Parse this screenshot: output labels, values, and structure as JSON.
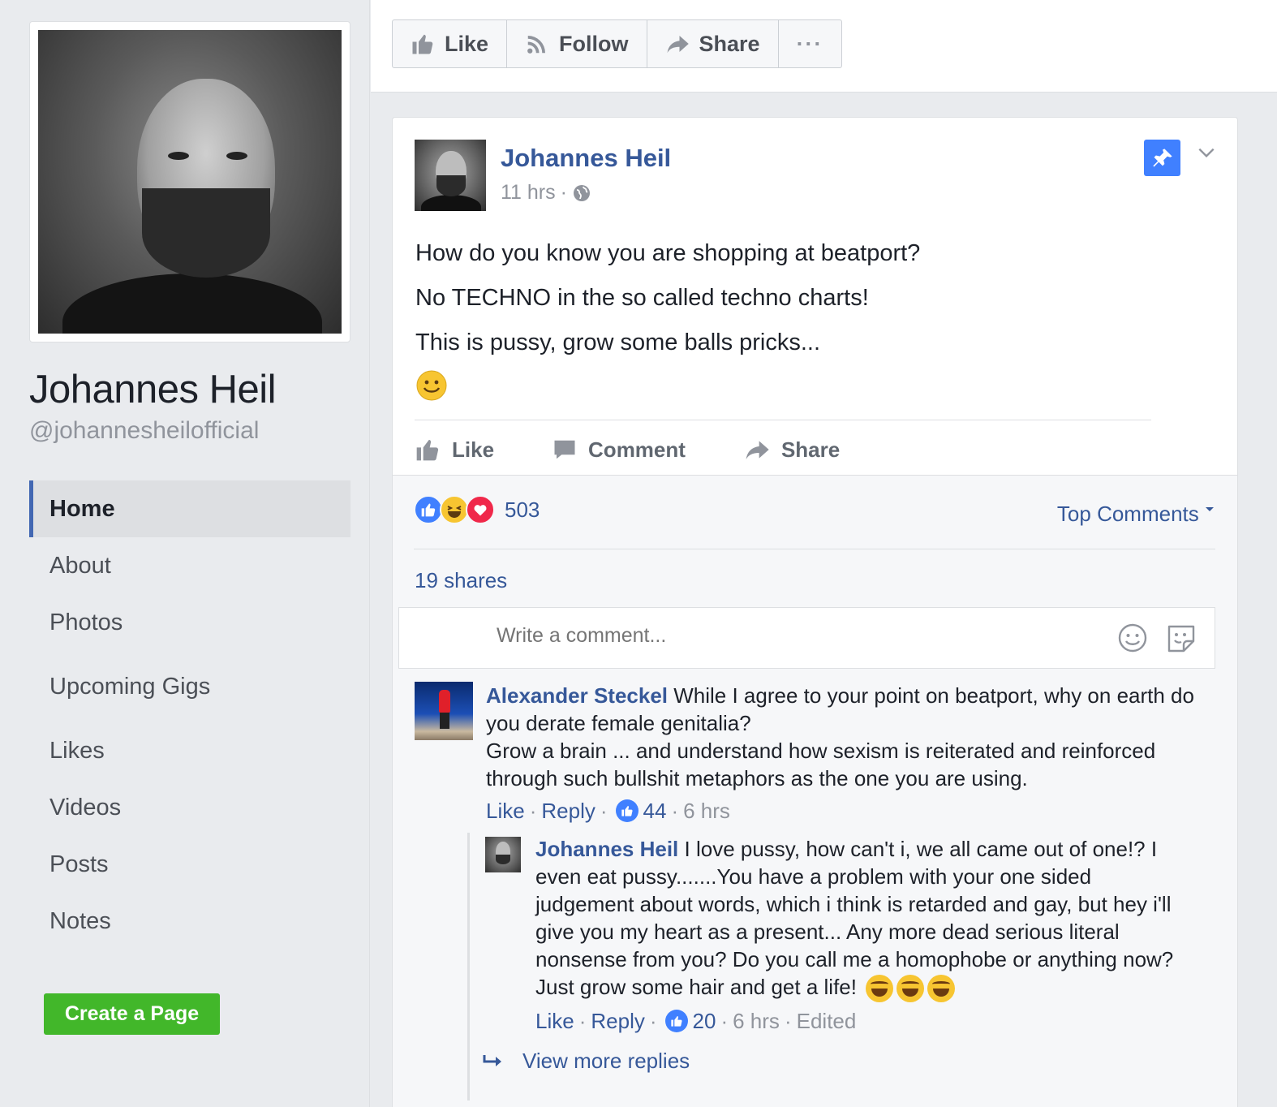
{
  "page": {
    "name": "Johannes Heil",
    "handle": "@johannesheilofficial"
  },
  "nav": {
    "items": [
      {
        "label": "Home"
      },
      {
        "label": "About"
      },
      {
        "label": "Photos"
      },
      {
        "label": "Upcoming Gigs"
      },
      {
        "label": "Likes"
      },
      {
        "label": "Videos"
      },
      {
        "label": "Posts"
      },
      {
        "label": "Notes"
      }
    ],
    "create_page": "Create a Page"
  },
  "actions": {
    "like": "Like",
    "follow": "Follow",
    "share": "Share",
    "more": "···"
  },
  "post": {
    "author": "Johannes Heil",
    "time": "11 hrs",
    "separator": "·",
    "lines": [
      "How do you know you are shopping at beatport?",
      "No TECHNO in the so called techno charts!",
      "This is pussy, grow some balls pricks..."
    ],
    "buttons": {
      "like": "Like",
      "comment": "Comment",
      "share": "Share"
    }
  },
  "feedback": {
    "reaction_count": "503",
    "top_comments": "Top Comments",
    "shares": "19 shares",
    "write_placeholder": "Write a comment..."
  },
  "comments": [
    {
      "author": "Alexander Steckel",
      "text1": "While I agree to your point on beatport, why on earth do you derate female genitalia?",
      "text2": "Grow a brain ... and understand how sexism is reiterated and reinforced through such bullshit metaphors as the one you are using.",
      "like": "Like",
      "reply": "Reply",
      "likes": "44",
      "time": "6 hrs"
    },
    {
      "author": "Johannes Heil",
      "text": "I love pussy, how can't i, we all came out of one!? I even eat pussy.......You have a problem with your one sided judgement about words, which i think is retarded and gay, but hey i'll give you my heart as a present... Any more dead serious literal nonsense from you? Do you call me a homophobe or anything now? Just grow some hair and get a life!",
      "like": "Like",
      "reply": "Reply",
      "likes": "20",
      "time": "6 hrs",
      "edited": "Edited"
    }
  ],
  "view_more_replies": "View more replies",
  "colors": {
    "link": "#365899",
    "accent": "#4267b2",
    "create_button": "#42b72a",
    "pin": "#4080ff",
    "love": "#f0284a",
    "haha": "#f7c531"
  }
}
